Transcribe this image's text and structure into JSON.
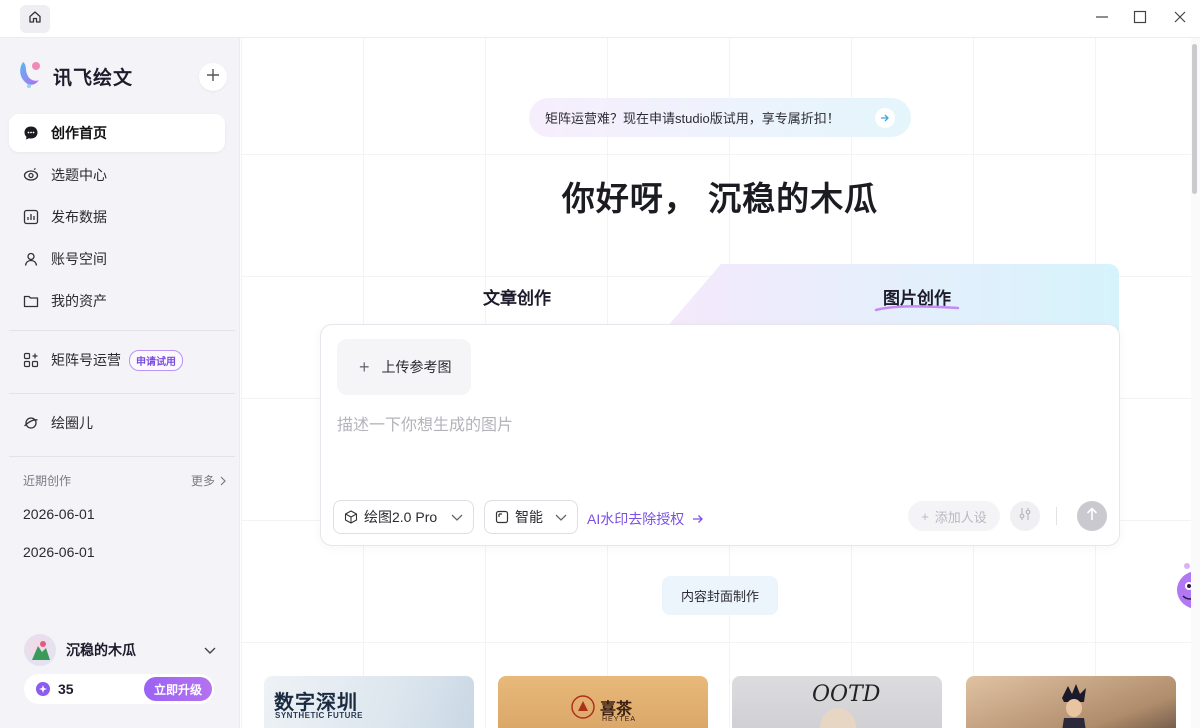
{
  "app": {
    "brand": "讯飞绘文",
    "colors": {
      "accent": "#7b4fe6",
      "sidebar_bg": "#f4f3f7",
      "upgrade": "#9a63f4"
    }
  },
  "titlebar": {
    "icons": [
      "home-icon",
      "minimize-icon",
      "maximize-icon",
      "close-icon"
    ]
  },
  "sidebar": {
    "nav": [
      {
        "label": "创作首页",
        "icon": "chat-bubble-icon",
        "active": true
      },
      {
        "label": "选题中心",
        "icon": "eye-icon"
      },
      {
        "label": "发布数据",
        "icon": "bar-chart-icon"
      },
      {
        "label": "账号空间",
        "icon": "user-icon"
      },
      {
        "label": "我的资产",
        "icon": "folder-icon"
      }
    ],
    "matrix": {
      "label": "矩阵号运营",
      "badge": "申请试用",
      "icon": "grid-plus-icon"
    },
    "circle": {
      "label": "绘圈儿",
      "icon": "planet-icon"
    },
    "recent": {
      "title": "近期创作",
      "more": "更多",
      "items": [
        "2026-06-01",
        "2026-06-01"
      ]
    },
    "user": {
      "name": "沉稳的木瓜",
      "points": "35",
      "upgrade": "立即升级"
    }
  },
  "main": {
    "promo": "矩阵运营难？现在申请studio版试用，享专属折扣！",
    "greeting": "你好呀， 沉稳的木瓜",
    "tabs": [
      {
        "label": "文章创作",
        "active": false
      },
      {
        "label": "图片创作",
        "active": true
      }
    ],
    "composer": {
      "upload": "上传参考图",
      "placeholder": "描述一下你想生成的图片",
      "model": "绘图2.0 Pro",
      "ratio": "智能",
      "watermark": "AI水印去除授权",
      "add_persona": "添加人设"
    },
    "cover_chip": "内容封面制作",
    "gallery": [
      {
        "title": "数字深圳",
        "subtitle": "SYNTHETIC FUTURE"
      },
      {
        "title": "喜茶",
        "subtitle": "HEYTEA"
      },
      {
        "title": "OOTD"
      },
      {
        "title": ""
      }
    ]
  }
}
